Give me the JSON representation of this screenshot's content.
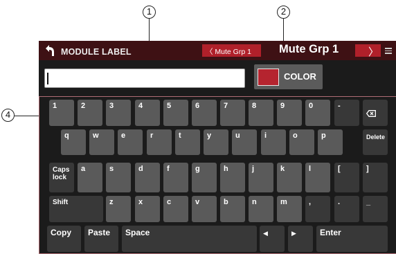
{
  "callouts": {
    "one": "1",
    "two": "2",
    "four": "4"
  },
  "header": {
    "title": "MODULE LABEL",
    "group_prev": "〈 Mute Grp 1",
    "group_current": "Mute Grp 1",
    "next_symbol": "〉"
  },
  "name_input": {
    "value": ""
  },
  "color_button": {
    "label": "COLOR",
    "swatch": "#b5242f"
  },
  "keyboard": {
    "row1": [
      "1",
      "2",
      "3",
      "4",
      "5",
      "6",
      "7",
      "8",
      "9",
      "0",
      "-"
    ],
    "row2": [
      "q",
      "w",
      "e",
      "r",
      "t",
      "y",
      "u",
      "i",
      "o",
      "p"
    ],
    "delete": "Delete",
    "caps": "Caps\nlock",
    "row3": [
      "a",
      "s",
      "d",
      "f",
      "g",
      "h",
      "j",
      "k",
      "l",
      "[",
      "]"
    ],
    "shift": "Shift",
    "row4": [
      "z",
      "x",
      "c",
      "v",
      "b",
      "n",
      "m",
      ",",
      ".",
      "_"
    ],
    "copy": "Copy",
    "paste": "Paste",
    "space": "Space",
    "left_arrow": "◀",
    "right_arrow": "▶",
    "enter": "Enter"
  },
  "colors": {
    "title_bar": "#3e1114",
    "accent": "#b0202a",
    "key": "#5a5a5a",
    "key_dark": "#383838",
    "screen": "#1b1b1b"
  }
}
